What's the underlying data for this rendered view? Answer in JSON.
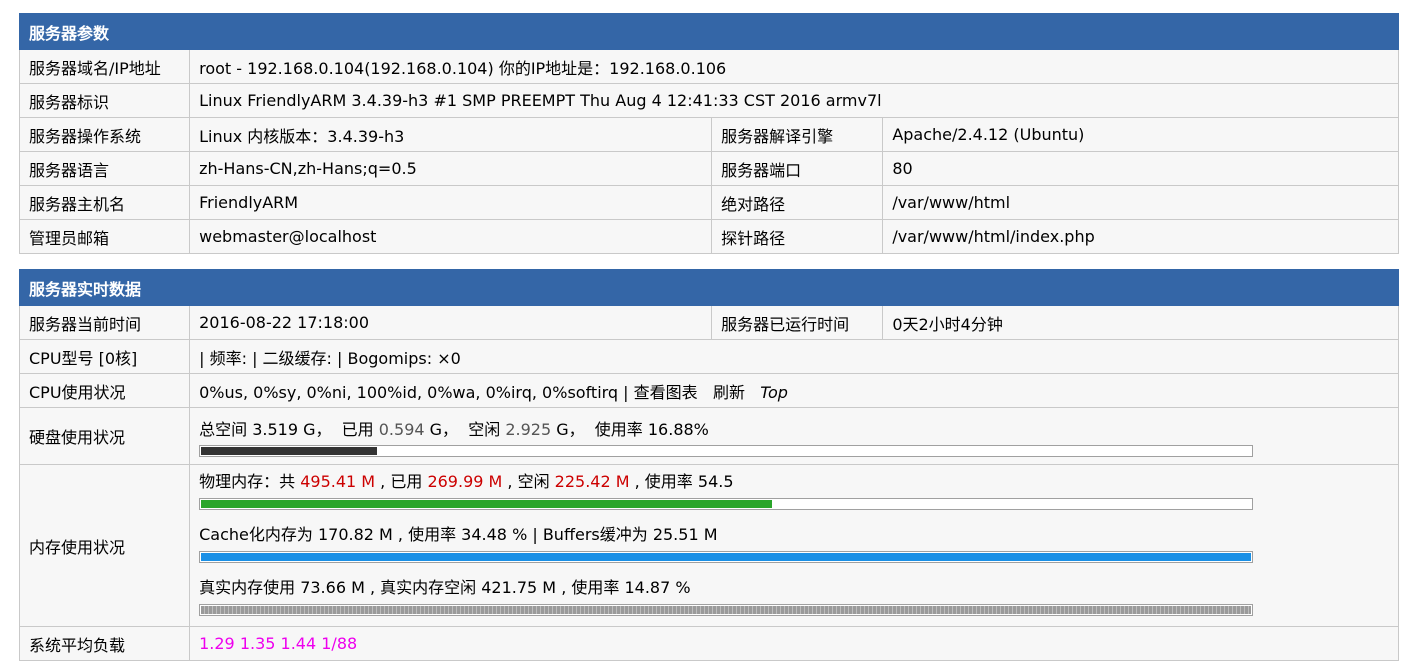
{
  "params": {
    "title": "服务器参数",
    "rows": [
      {
        "label": "服务器域名/IP地址",
        "value": "root - 192.168.0.104(192.168.0.104)  你的IP地址是：192.168.0.106"
      },
      {
        "label": "服务器标识",
        "value": "Linux FriendlyARM 3.4.39-h3 #1 SMP PREEMPT Thu Aug 4 12:41:33 CST 2016 armv7l"
      }
    ],
    "pairs": [
      {
        "label1": "服务器操作系统",
        "value1": "Linux  内核版本：3.4.39-h3",
        "label2": "服务器解译引擎",
        "value2": "Apache/2.4.12 (Ubuntu)"
      },
      {
        "label1": "服务器语言",
        "value1": "zh-Hans-CN,zh-Hans;q=0.5",
        "label2": "服务器端口",
        "value2": "80"
      },
      {
        "label1": "服务器主机名",
        "value1": "FriendlyARM",
        "label2": "绝对路径",
        "value2": "/var/www/html"
      },
      {
        "label1": "管理员邮箱",
        "value1": "webmaster@localhost",
        "label2": "探针路径",
        "value2": "/var/www/html/index.php"
      }
    ]
  },
  "realtime": {
    "title": "服务器实时数据",
    "time": {
      "label": "服务器当前时间",
      "value": "2016-08-22 17:18:00",
      "uptime_label": "服务器已运行时间",
      "uptime_value": "0天2小时4分钟"
    },
    "cpu_model": {
      "label": "CPU型号 [0核]",
      "value": "| 频率: | 二级缓存: | Bogomips: ×0"
    },
    "cpu_usage": {
      "label": "CPU使用状况",
      "value": "0%us, 0%sy, 0%ni, 100%id, 0%wa, 0%irq, 0%softirq | ",
      "chart_link": "查看图表",
      "refresh_link": "刷新",
      "top_link": "Top"
    },
    "disk": {
      "label": "硬盘使用状况",
      "t1": "总空间 3.519 G，  已用 ",
      "used": "0.594",
      "t2": " G，  空闲 ",
      "free": "2.925",
      "t3": " G，  使用率 16.88%",
      "usage_fraction": 0.1688,
      "bar_color": "#333333"
    },
    "memory": {
      "label": "内存使用状况",
      "physical": {
        "t1": "物理内存：共 ",
        "total": "495.41 M",
        "t2": " , 已用 ",
        "used": "269.99 M",
        "t3": " , 空闲 ",
        "free": "225.42 M",
        "t4": " , 使用率 54.5",
        "usage_fraction": 0.545,
        "bar_color": "#2aa52a"
      },
      "cache": {
        "text": "Cache化内存为 170.82 M , 使用率 34.48 % | Buffers缓冲为 25.51 M",
        "usage_fraction": 1.0,
        "bar_color": "#1a90e6"
      },
      "real": {
        "text": "真实内存使用 73.66 M , 真实内存空闲 421.75 M , 使用率 14.87 %",
        "usage_fraction": 1.0,
        "bar_color": "#9a9a9a"
      }
    },
    "load": {
      "label": "系统平均负载",
      "value": "1.29 1.35 1.44 1/88",
      "color": "#ee00ee"
    }
  }
}
